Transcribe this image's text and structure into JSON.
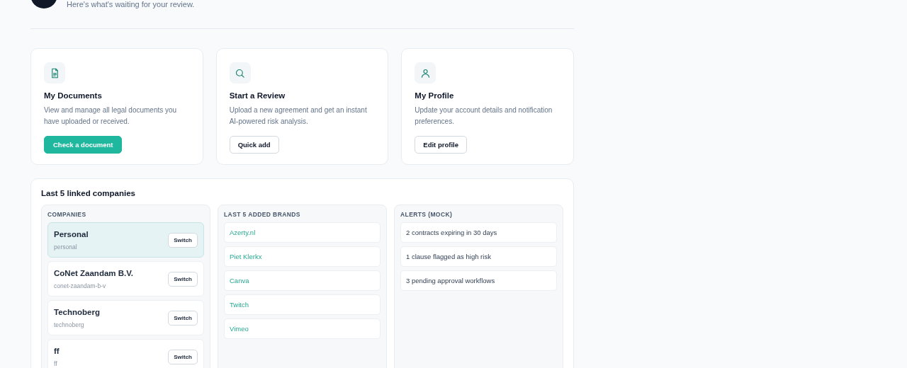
{
  "header": {
    "subtitle": "Here's what's waiting for your review."
  },
  "cards": [
    {
      "kind": "documents",
      "title": "My Documents",
      "description": "View and manage all legal documents you have uploaded or received.",
      "button": {
        "label": "Check a document",
        "primary": true
      }
    },
    {
      "kind": "search",
      "title": "Start a Review",
      "description": "Upload a new agreement and get an instant AI-powered risk analysis.",
      "button": {
        "label": "Quick add",
        "primary": false
      }
    },
    {
      "kind": "profile",
      "title": "My Profile",
      "description": "Update your account details and notification preferences.",
      "button": {
        "label": "Edit profile",
        "primary": false
      }
    }
  ],
  "linked": {
    "title": "Last 5 linked companies",
    "companies": {
      "heading": "COMPANIES",
      "items": [
        {
          "name": "Personal",
          "slug": "personal",
          "button": "Switch",
          "selected": true
        },
        {
          "name": "CoNet Zaandam B.V.",
          "slug": "conet-zaandam-b-v",
          "button": "Switch",
          "selected": false
        },
        {
          "name": "Technoberg",
          "slug": "technoberg",
          "button": "Switch",
          "selected": false
        },
        {
          "name": "ff",
          "slug": "ff",
          "button": "Switch",
          "selected": false
        }
      ]
    },
    "brands": {
      "heading": "LAST 5 ADDED BRANDS",
      "items": [
        "Azerty.nl",
        "Piet Klerkx",
        "Canva",
        "Twitch",
        "Vimeo"
      ]
    },
    "alerts": {
      "heading": "ALERTS (MOCK)",
      "items": [
        "2 contracts expiring in 30 days",
        "1 clause flagged as high risk",
        "3 pending approval workflows"
      ]
    }
  }
}
